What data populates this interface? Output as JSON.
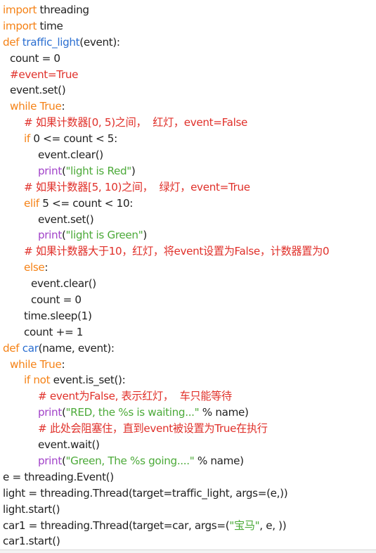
{
  "colors": {
    "keyword": "#f58216",
    "function_name": "#2b6fd1",
    "string": "#4caa39",
    "builtin": "#a243c9",
    "comment": "#e0302a",
    "text": "#222222"
  },
  "code": {
    "lines": [
      {
        "indent": 0,
        "segments": [
          {
            "t": "kw",
            "s": "import"
          },
          {
            "t": "tx",
            "s": " threading"
          }
        ]
      },
      {
        "indent": 0,
        "segments": [
          {
            "t": "kw",
            "s": "import"
          },
          {
            "t": "tx",
            "s": " time"
          }
        ]
      },
      {
        "indent": 0,
        "segments": [
          {
            "t": "kw",
            "s": "def"
          },
          {
            "t": "tx",
            "s": " "
          },
          {
            "t": "fn",
            "s": "traffic_light"
          },
          {
            "t": "tx",
            "s": "(event):"
          }
        ]
      },
      {
        "indent": 10,
        "segments": [
          {
            "t": "tx",
            "s": "count = 0"
          }
        ]
      },
      {
        "indent": 10,
        "segments": [
          {
            "t": "cm",
            "s": "#event=True"
          }
        ]
      },
      {
        "indent": 10,
        "segments": [
          {
            "t": "tx",
            "s": "event.set()"
          }
        ]
      },
      {
        "indent": 10,
        "segments": [
          {
            "t": "kw",
            "s": "while"
          },
          {
            "t": "tx",
            "s": " "
          },
          {
            "t": "kw",
            "s": "True"
          },
          {
            "t": "tx",
            "s": ":"
          }
        ]
      },
      {
        "indent": 30,
        "segments": [
          {
            "t": "cm",
            "s": "# 如果计数器[0, 5)之间，  红灯，event=False"
          }
        ]
      },
      {
        "indent": 30,
        "segments": [
          {
            "t": "kw",
            "s": "if"
          },
          {
            "t": "tx",
            "s": " 0 <= count < 5:"
          }
        ]
      },
      {
        "indent": 50,
        "segments": [
          {
            "t": "tx",
            "s": "event.clear()"
          }
        ]
      },
      {
        "indent": 50,
        "segments": [
          {
            "t": "bi",
            "s": "print"
          },
          {
            "t": "tx",
            "s": "("
          },
          {
            "t": "str",
            "s": "\"light is Red\""
          },
          {
            "t": "tx",
            "s": ")"
          }
        ]
      },
      {
        "indent": 30,
        "segments": [
          {
            "t": "cm",
            "s": "# 如果计数器[5, 10)之间，  绿灯，event=True"
          }
        ]
      },
      {
        "indent": 30,
        "segments": [
          {
            "t": "kw",
            "s": "elif"
          },
          {
            "t": "tx",
            "s": " 5 <= count < 10:"
          }
        ]
      },
      {
        "indent": 50,
        "segments": [
          {
            "t": "tx",
            "s": "event.set()"
          }
        ]
      },
      {
        "indent": 50,
        "segments": [
          {
            "t": "bi",
            "s": "print"
          },
          {
            "t": "tx",
            "s": "("
          },
          {
            "t": "str",
            "s": "\"light is Green\""
          },
          {
            "t": "tx",
            "s": ")"
          }
        ]
      },
      {
        "indent": 30,
        "segments": [
          {
            "t": "cm",
            "s": "# 如果计数器大于10，红灯，将event设置为False，计数器置为0"
          }
        ]
      },
      {
        "indent": 30,
        "segments": [
          {
            "t": "kw",
            "s": "else"
          },
          {
            "t": "tx",
            "s": ":"
          }
        ]
      },
      {
        "indent": 40,
        "segments": [
          {
            "t": "tx",
            "s": "event.clear()"
          }
        ]
      },
      {
        "indent": 40,
        "segments": [
          {
            "t": "tx",
            "s": "count = 0"
          }
        ]
      },
      {
        "indent": 30,
        "segments": [
          {
            "t": "tx",
            "s": "time.sleep(1)"
          }
        ]
      },
      {
        "indent": 30,
        "segments": [
          {
            "t": "tx",
            "s": "count += 1"
          }
        ]
      },
      {
        "indent": 0,
        "segments": [
          {
            "t": "kw",
            "s": "def"
          },
          {
            "t": "tx",
            "s": " "
          },
          {
            "t": "fn",
            "s": "car"
          },
          {
            "t": "tx",
            "s": "(name, event):"
          }
        ]
      },
      {
        "indent": 10,
        "segments": [
          {
            "t": "kw",
            "s": "while"
          },
          {
            "t": "tx",
            "s": " "
          },
          {
            "t": "kw",
            "s": "True"
          },
          {
            "t": "tx",
            "s": ":"
          }
        ]
      },
      {
        "indent": 30,
        "segments": [
          {
            "t": "kw",
            "s": "if"
          },
          {
            "t": "tx",
            "s": " "
          },
          {
            "t": "kw",
            "s": "not"
          },
          {
            "t": "tx",
            "s": " event.is_set():"
          }
        ]
      },
      {
        "indent": 50,
        "segments": [
          {
            "t": "cm",
            "s": "# event为False, 表示红灯，  车只能等待"
          }
        ]
      },
      {
        "indent": 50,
        "segments": [
          {
            "t": "bi",
            "s": "print"
          },
          {
            "t": "tx",
            "s": "("
          },
          {
            "t": "str",
            "s": "\"RED, the %s is waiting...\""
          },
          {
            "t": "tx",
            "s": " % name)"
          }
        ]
      },
      {
        "indent": 50,
        "segments": [
          {
            "t": "cm",
            "s": "# 此处会阻塞住，直到event被设置为True在执行"
          }
        ]
      },
      {
        "indent": 50,
        "segments": [
          {
            "t": "tx",
            "s": "event.wait()"
          }
        ]
      },
      {
        "indent": 50,
        "segments": [
          {
            "t": "bi",
            "s": "print"
          },
          {
            "t": "tx",
            "s": "("
          },
          {
            "t": "str",
            "s": "\"Green, The %s going....\""
          },
          {
            "t": "tx",
            "s": " % name)"
          }
        ]
      },
      {
        "indent": 0,
        "segments": [
          {
            "t": "tx",
            "s": "e = threading.Event()"
          }
        ]
      },
      {
        "indent": 0,
        "segments": [
          {
            "t": "tx",
            "s": "light = threading.Thread(target=traffic_light, args=(e,))"
          }
        ]
      },
      {
        "indent": 0,
        "segments": [
          {
            "t": "tx",
            "s": "light.start()"
          }
        ]
      },
      {
        "indent": 0,
        "segments": [
          {
            "t": "tx",
            "s": "car1 = threading.Thread(target=car, args=("
          },
          {
            "t": "str",
            "s": "\"宝马\""
          },
          {
            "t": "tx",
            "s": ", e, ))"
          }
        ]
      },
      {
        "indent": 0,
        "segments": [
          {
            "t": "tx",
            "s": "car1.start()"
          }
        ]
      }
    ]
  }
}
